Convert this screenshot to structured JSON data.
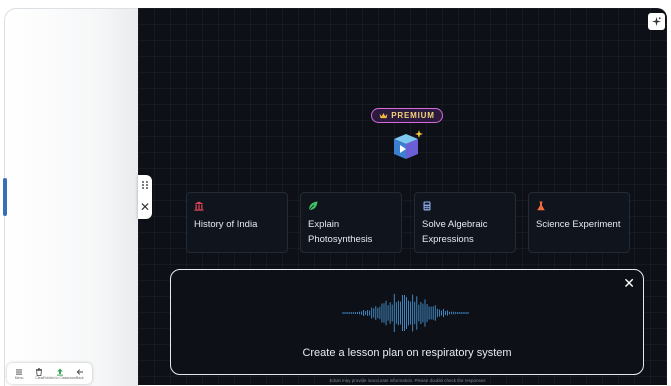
{
  "premium": {
    "label": "PREMIUM",
    "crown_icon": "crown-icon"
  },
  "logo": {
    "icon": "cube-sparkle-logo"
  },
  "corner_button": {
    "icon": "sparkle-icon"
  },
  "splitter": {
    "grip_icon": "drag-handle-icon",
    "close_glyph": "✕"
  },
  "suggestions": [
    {
      "label_line1": "History of India",
      "label_line2": "",
      "icon": "temple-icon",
      "icon_color": "#e0445b"
    },
    {
      "label_line1": "Explain",
      "label_line2": "Photosynthesis",
      "icon": "leaf-icon",
      "icon_color": "#41c463"
    },
    {
      "label_line1": "Solve Algebraic",
      "label_line2": "Expressions",
      "icon": "calculator-icon",
      "icon_color": "#8aa9e6"
    },
    {
      "label_line1": "Science Experiment",
      "label_line2": "",
      "icon": "flask-icon",
      "icon_color": "#f06a3c"
    }
  ],
  "voice": {
    "transcript": "Create a lesson plan on respiratory system",
    "close_glyph": "✕",
    "wave_color": "#4ea1e8"
  },
  "disclaimer": "Eduki may provide inaccurate information. Please double check the responses",
  "toolbar": {
    "items": [
      {
        "label": "Menu",
        "icon": "menu-icon"
      },
      {
        "label": "Clear",
        "icon": "trash-icon"
      },
      {
        "label": "Publish to Classroom",
        "icon": "upload-icon"
      },
      {
        "label": "Back",
        "icon": "back-arrow-icon"
      }
    ]
  },
  "colors": {
    "background": "#0d1117",
    "premium_border": "#d46bd8",
    "premium_text": "#f3d27a",
    "accent_blue": "#3a6fb6"
  }
}
